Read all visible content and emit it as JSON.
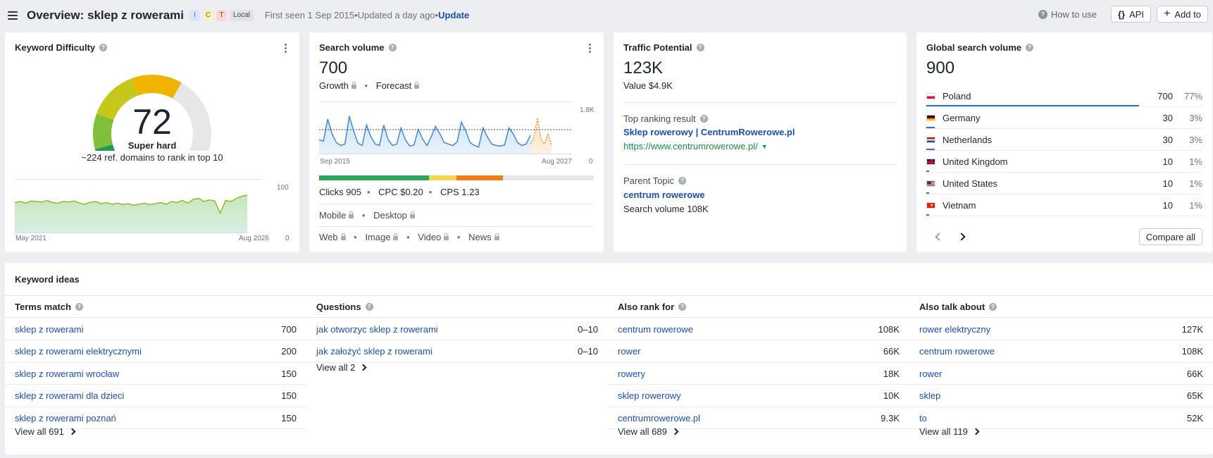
{
  "header": {
    "title": "Overview: sklep z rowerami",
    "intents": [
      "I",
      "C",
      "T"
    ],
    "local_badge": "Local",
    "first_seen": "First seen 1 Sep 2015",
    "updated": "Updated a day ago",
    "update_link": "Update",
    "how_to_use": "How to use",
    "api_label": "API",
    "add_to_label": "Add to"
  },
  "kd": {
    "title": "Keyword Difficulty",
    "score": "72",
    "level": "Super hard",
    "desc": "~224 ref. domains to rank in top 10",
    "chart_start": "May 2021",
    "chart_end": "Aug 2026",
    "ymax": "100",
    "ymin": "0",
    "gauge_colors": [
      "#1e9a55",
      "#7fbf3a",
      "#c5c81a",
      "#f0b400",
      "#e6e7e9"
    ]
  },
  "sv": {
    "title": "Search volume",
    "value": "700",
    "growth": "Growth",
    "forecast": "Forecast",
    "x_start": "Sep 2015",
    "x_end": "Aug 2027",
    "y_top": "1.8K",
    "y_bottom": "0",
    "clicks": "Clicks 905",
    "cpc": "CPC $0.20",
    "cps": "CPS 1.23",
    "mobile": "Mobile",
    "desktop": "Desktop",
    "web": "Web",
    "image": "Image",
    "video": "Video",
    "news": "News",
    "click_bar": [
      {
        "share": 0.4,
        "color": "#2ea45a"
      },
      {
        "share": 0.1,
        "color": "#f3d54e"
      },
      {
        "share": 0.17,
        "color": "#f07c1a"
      },
      {
        "share": 0.33,
        "color": "#e6e7e9"
      }
    ]
  },
  "chart_data": [
    {
      "type": "area",
      "title": "Search volume",
      "x_start": "Sep 2015",
      "x_end": "Aug 2027",
      "ylim": [
        0,
        1800
      ],
      "series": [
        {
          "values": [
            500,
            450,
            1200,
            700,
            400,
            300,
            350,
            1300,
            800,
            380,
            300,
            1000,
            600,
            350,
            300,
            1000,
            500,
            300,
            350,
            900,
            500,
            280,
            320,
            850,
            520,
            300,
            600,
            950,
            700,
            400,
            350,
            300,
            420,
            1100,
            800,
            400,
            300,
            250,
            900,
            600,
            350,
            300,
            280,
            320,
            900,
            700,
            400,
            300,
            350,
            650
          ]
        },
        {
          "values": [
            350,
            600,
            1250,
            500,
            350,
            700,
            300
          ]
        }
      ]
    },
    {
      "type": "line",
      "title": "Keyword Difficulty",
      "x_start": "May 2021",
      "x_end": "Aug 2026",
      "ylim": [
        0,
        100
      ],
      "values": [
        58,
        60,
        57,
        61,
        60,
        59,
        62,
        58,
        57,
        60,
        59,
        61,
        57,
        55,
        59,
        60,
        56,
        58,
        55,
        57,
        54,
        56,
        53,
        55,
        57,
        54,
        56,
        58,
        55,
        60,
        58,
        62,
        57,
        64,
        66,
        60,
        63,
        61,
        38,
        62,
        60,
        66,
        70,
        72
      ]
    }
  ],
  "tp": {
    "title": "Traffic Potential",
    "value": "123K",
    "value_usd": "Value $4.9K",
    "top_label": "Top ranking result",
    "top_title": "Sklep rowerowy | CentrumRowerowe.pl",
    "top_url": "https://www.centrumrowerowe.pl/",
    "parent_label": "Parent Topic",
    "parent_topic": "centrum rowerowe",
    "parent_volume": "Search volume 108K"
  },
  "gsv": {
    "title": "Global search volume",
    "value": "900",
    "countries": [
      {
        "name": "Poland",
        "value": "700",
        "pct": "77%",
        "share": 0.77,
        "flag": "pl"
      },
      {
        "name": "Germany",
        "value": "30",
        "pct": "3%",
        "share": 0.03,
        "flag": "de"
      },
      {
        "name": "Netherlands",
        "value": "30",
        "pct": "3%",
        "share": 0.03,
        "flag": "nl"
      },
      {
        "name": "United Kingdom",
        "value": "10",
        "pct": "1%",
        "share": 0.01,
        "flag": "gb"
      },
      {
        "name": "United States",
        "value": "10",
        "pct": "1%",
        "share": 0.01,
        "flag": "us"
      },
      {
        "name": "Vietnam",
        "value": "10",
        "pct": "1%",
        "share": 0.01,
        "flag": "vn"
      }
    ],
    "compare_label": "Compare all"
  },
  "ideas": {
    "title": "Keyword ideas",
    "columns": [
      {
        "header": "Terms match",
        "rows": [
          {
            "t": "sklep z rowerami",
            "n": "700"
          },
          {
            "t": "sklep z rowerami elektrycznymi",
            "n": "200"
          },
          {
            "t": "sklep z rowerami wrocław",
            "n": "150"
          },
          {
            "t": "sklep z rowerami dla dzieci",
            "n": "150"
          },
          {
            "t": "sklep z rowerami poznań",
            "n": "150"
          }
        ],
        "view_all": "View all 691"
      },
      {
        "header": "Questions",
        "rows": [
          {
            "t": "jak otworzyc sklep z rowerami",
            "n": "0–10"
          },
          {
            "t": "jak założyć sklep z rowerami",
            "n": "0–10"
          }
        ],
        "view_all": "View all 2"
      },
      {
        "header": "Also rank for",
        "rows": [
          {
            "t": "centrum rowerowe",
            "n": "108K"
          },
          {
            "t": "rower",
            "n": "66K"
          },
          {
            "t": "rowery",
            "n": "18K"
          },
          {
            "t": "sklep rowerowy",
            "n": "10K"
          },
          {
            "t": "centrumrowerowe.pl",
            "n": "9.3K"
          }
        ],
        "view_all": "View all 689"
      },
      {
        "header": "Also talk about",
        "rows": [
          {
            "t": "rower elektryczny",
            "n": "127K"
          },
          {
            "t": "centrum rowerowe",
            "n": "108K"
          },
          {
            "t": "rower",
            "n": "66K"
          },
          {
            "t": "sklep",
            "n": "65K"
          },
          {
            "t": "to",
            "n": "52K"
          }
        ],
        "view_all": "View all 119"
      }
    ]
  }
}
